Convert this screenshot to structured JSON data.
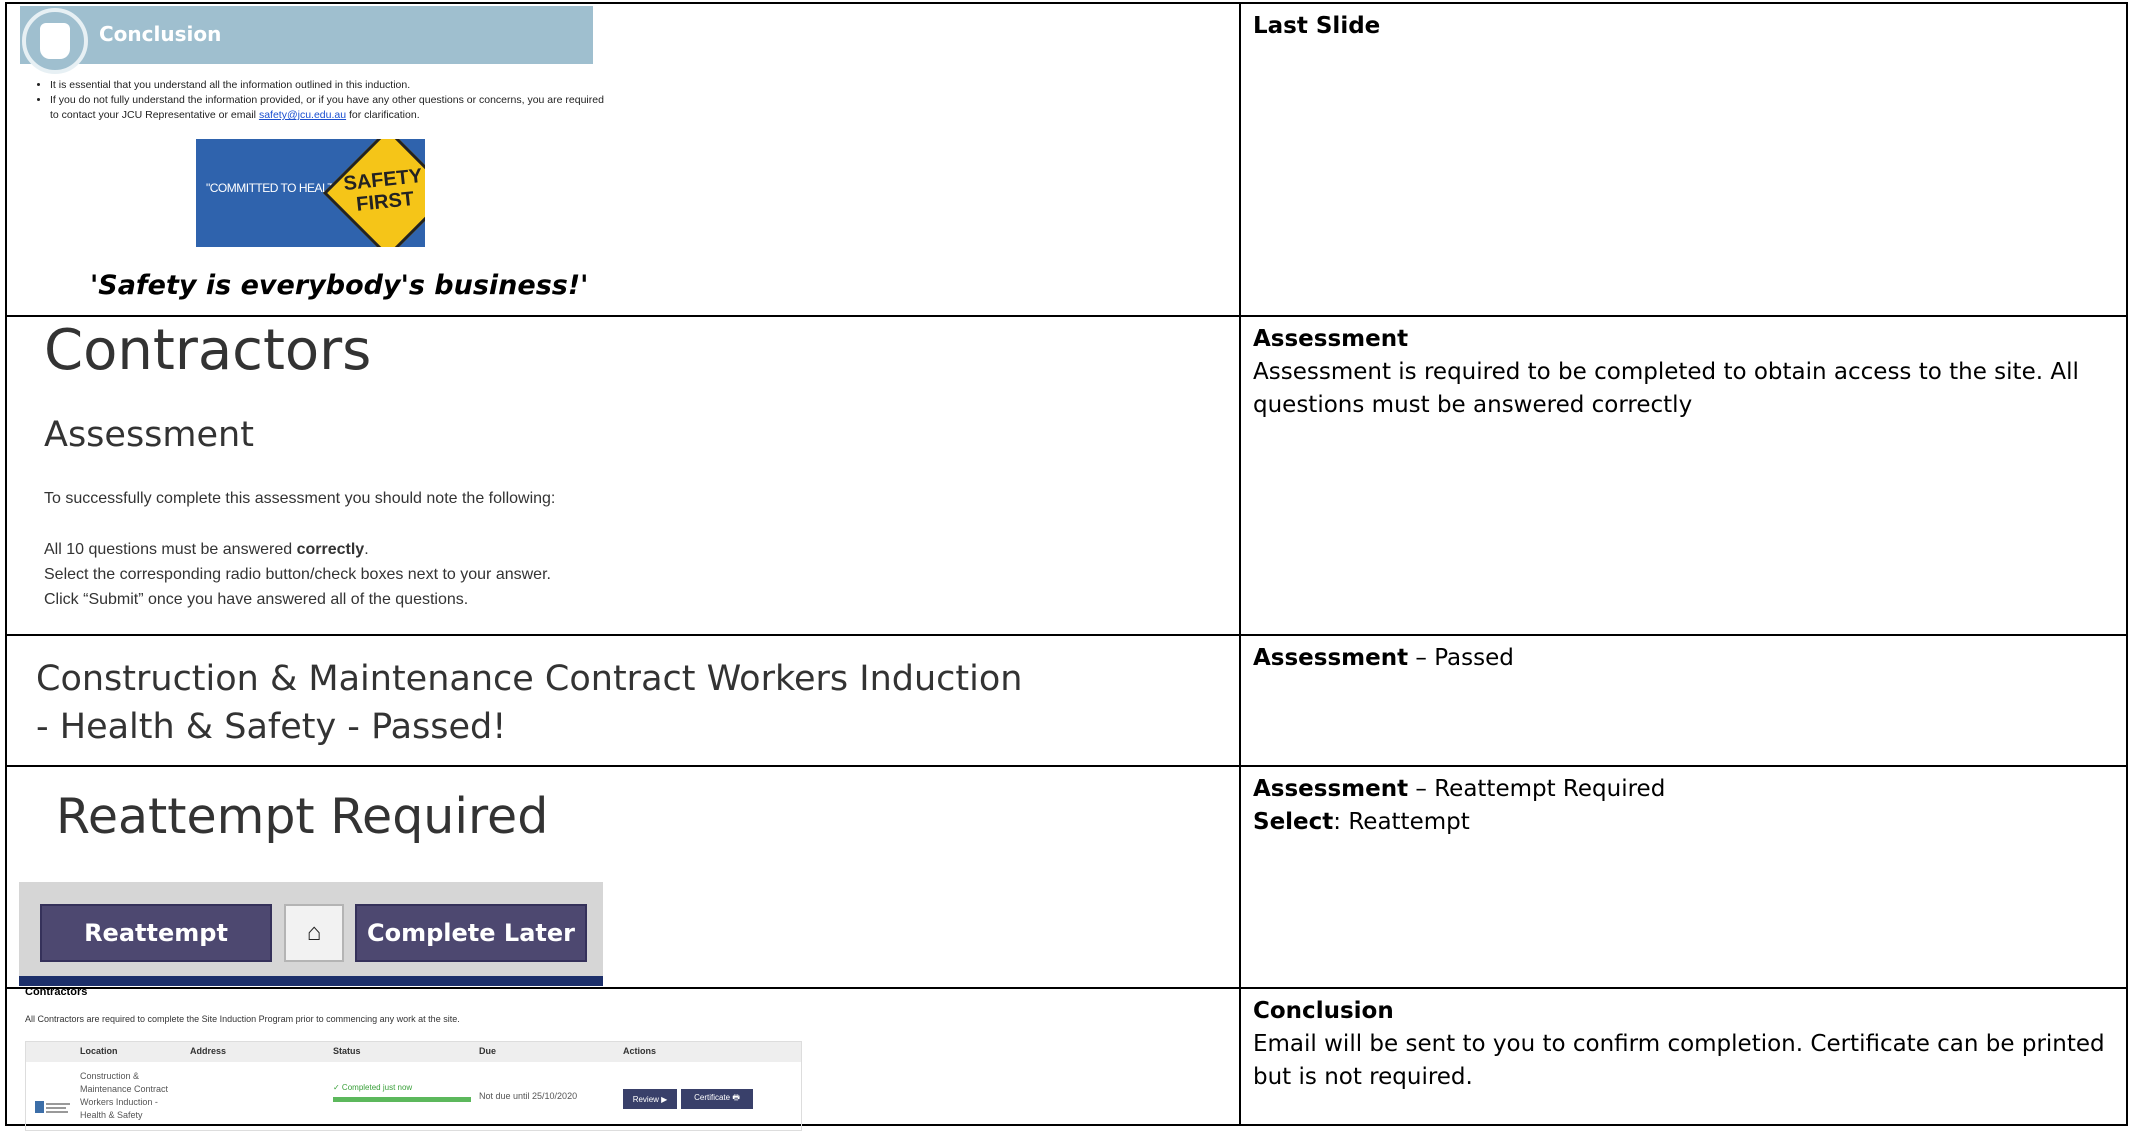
{
  "rows": [
    {
      "slide": {
        "banner_title": "Conclusion",
        "bullets": [
          "It is essential that you understand all the information outlined in this induction.",
          "If you do not fully understand the information provided, or if you have any other questions or concerns, you are required to contact your JCU Representative or email",
          "safety@jcu.edu.au",
          "for clarification."
        ],
        "image_committed": "\"COMMITTED TO HEALTH & SAFETY\"",
        "image_sign": "SAFETY FIRST",
        "slogan": "'Safety is everybody's business!'"
      },
      "note": {
        "title": "Last Slide"
      }
    },
    {
      "slide": {
        "heading": "Contractors",
        "subheading": "Assessment",
        "intro": "To successfully complete this assessment you should note the following:",
        "line1_prefix": "All 10 questions must be answered ",
        "line1_bold": "correctly",
        "line1_suffix": ".",
        "line2": "Select the corresponding radio button/check boxes next to your answer.",
        "line3": "Click “Submit” once you have answered all of the questions."
      },
      "note": {
        "title": "Assessment",
        "body": "Assessment is required to be completed to obtain access to the site.  All questions must be answered correctly"
      }
    },
    {
      "slide": {
        "title": "Construction & Maintenance Contract Workers Induction - Health & Safety - Passed!"
      },
      "note": {
        "title": "Assessment",
        "suffix": " – Passed"
      }
    },
    {
      "slide": {
        "title": "Reattempt Required",
        "reattempt_button": "Reattempt",
        "complete_later_button": "Complete Later",
        "home_icon": "home-icon"
      },
      "note": {
        "title": "Assessment",
        "suffix": " – Reattempt Required",
        "select_label": "Select",
        "select_value": ": Reattempt"
      }
    },
    {
      "slide": {
        "heading": "Contractors",
        "subtext": "All Contractors are required to complete the Site Induction Program prior to commencing any work at the site.",
        "columns": [
          "Location",
          "Address",
          "Status",
          "Due",
          "Actions"
        ],
        "row_location": "Construction & Maintenance Contract Workers Induction - Health & Safety",
        "row_status": "✓ Completed just now",
        "row_due": "Not due until 25/10/2020",
        "review_button": "Review ▶",
        "certificate_button": "Certificate 🖶"
      },
      "note": {
        "title": "Conclusion",
        "body": "Email will be sent to you to confirm completion.  Certificate can be printed but is not required."
      }
    }
  ]
}
